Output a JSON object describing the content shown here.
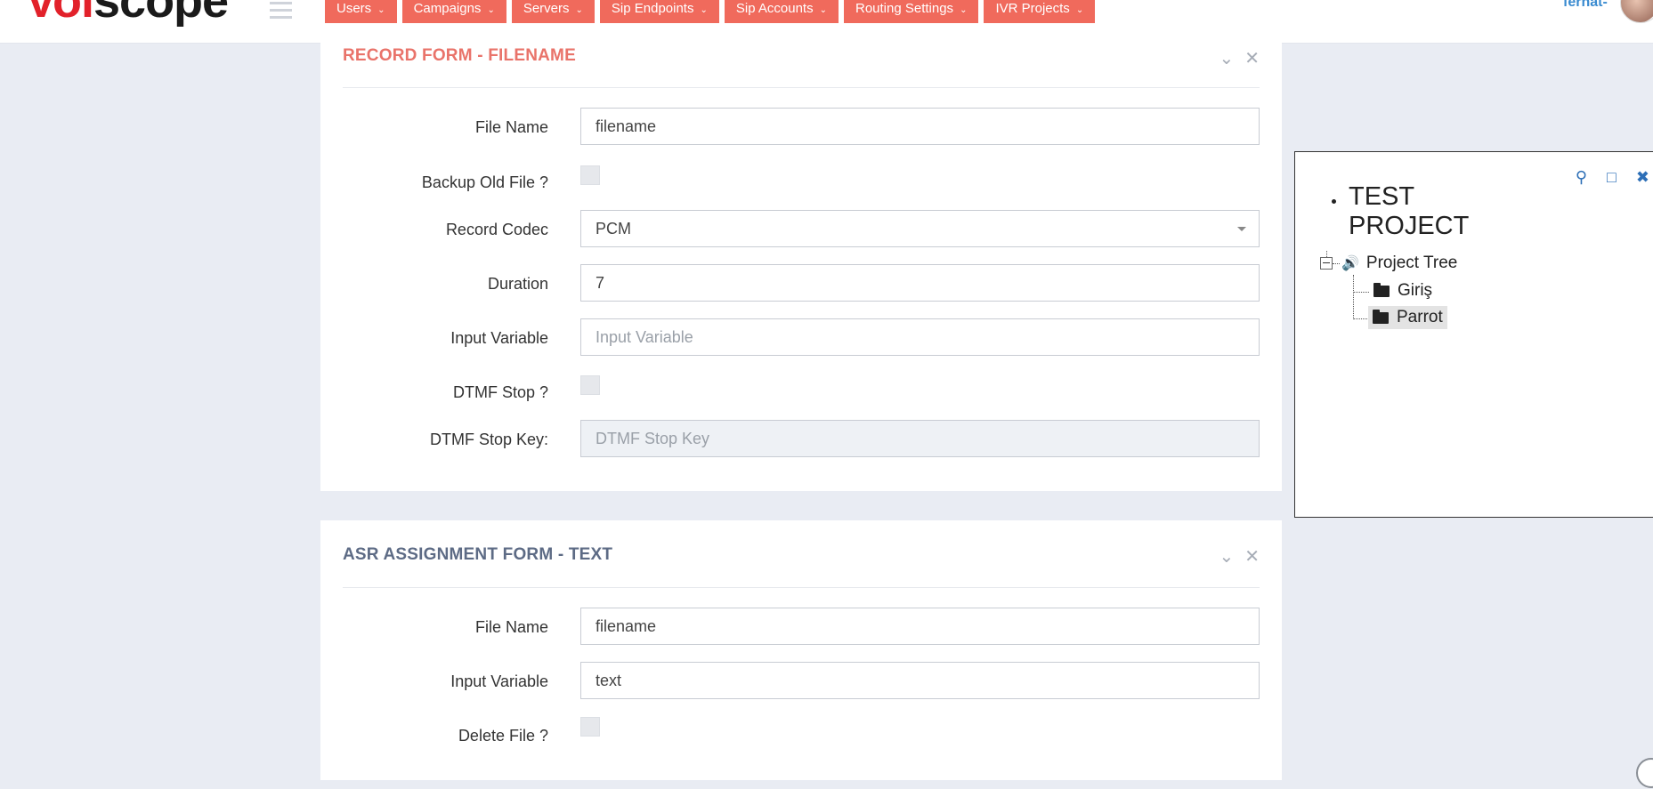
{
  "brand": {
    "logo_part1": "Voi",
    "logo_part2": "scope",
    "colors": {
      "red": "#e2212a",
      "menu": "#f06a5c",
      "link": "#3a8bd0"
    }
  },
  "nav": {
    "items": [
      {
        "label": "Users"
      },
      {
        "label": "Campaigns"
      },
      {
        "label": "Servers"
      },
      {
        "label": "Sip Endpoints"
      },
      {
        "label": "Sip Accounts"
      },
      {
        "label": "Routing Settings"
      },
      {
        "label": "IVR Projects"
      }
    ],
    "username": "ferhat-"
  },
  "record_form": {
    "title": "RECORD FORM - FILENAME",
    "fields": {
      "file_name_label": "File Name",
      "file_name_value": "filename",
      "backup_label": "Backup Old File ?",
      "codec_label": "Record Codec",
      "codec_value": "PCM",
      "duration_label": "Duration",
      "duration_value": "7",
      "input_var_label": "Input Variable",
      "input_var_placeholder": "Input Variable",
      "dtmf_stop_label": "DTMF Stop ?",
      "dtmf_key_label": "DTMF Stop Key:",
      "dtmf_key_placeholder": "DTMF Stop Key"
    }
  },
  "asr_form": {
    "title": "ASR ASSIGNMENT FORM - TEXT",
    "fields": {
      "file_name_label": "File Name",
      "file_name_value": "filename",
      "input_var_label": "Input Variable",
      "input_var_value": "text",
      "delete_label": "Delete File ?"
    }
  },
  "tree": {
    "project_title": "TEST PROJECT",
    "root_label": "Project Tree",
    "children": [
      {
        "label": "Giriş"
      },
      {
        "label": "Parrot"
      }
    ],
    "icons": [
      "search-icon",
      "maximize-icon",
      "close-icon"
    ]
  }
}
